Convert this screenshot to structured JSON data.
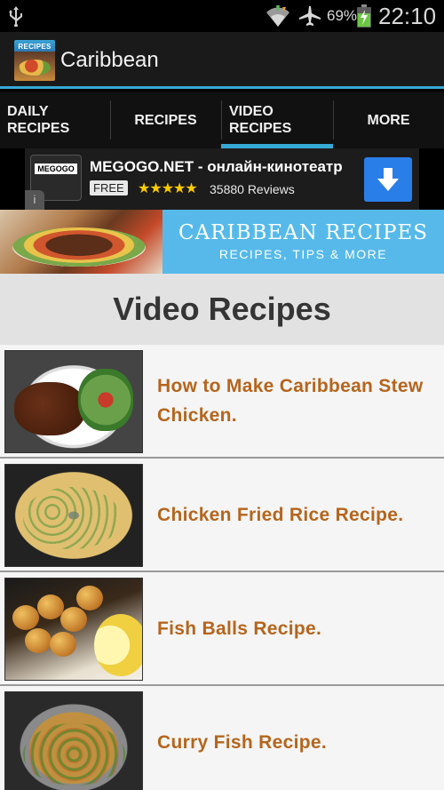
{
  "status_bar": {
    "battery_percent": "69%",
    "time": "22:10",
    "icons": [
      "usb-icon",
      "wifi-icon",
      "airplane-icon",
      "battery-charging-icon"
    ]
  },
  "action_bar": {
    "icon_label": "RECIPES",
    "title": "Caribbean"
  },
  "tabs": [
    {
      "label": "DAILY\nRECIPES",
      "active": false
    },
    {
      "label": "RECIPES",
      "active": false
    },
    {
      "label": "VIDEO\nRECIPES",
      "active": true
    },
    {
      "label": "MORE",
      "active": false
    }
  ],
  "ad": {
    "logo_text": "MEGOGO",
    "title": "MEGOGO.NET - онлайн-кинотеатр",
    "price": "FREE",
    "stars": "★★★★★",
    "rating": 4.5,
    "reviews": "35880 Reviews",
    "info_icon": "info-icon",
    "download_icon": "download-arrow-icon"
  },
  "header_banner": {
    "title": "CARIBBEAN RECIPES",
    "subtitle": "RECIPES, TIPS & MORE"
  },
  "page_heading": "Video Recipes",
  "videos": [
    {
      "title": "How to Make Caribbean Stew Chicken."
    },
    {
      "title": "Chicken Fried Rice Recipe."
    },
    {
      "title": "Fish Balls Recipe."
    },
    {
      "title": "Curry Fish Recipe."
    }
  ],
  "colors": {
    "accent": "#36a9d6",
    "link_text": "#b5651d",
    "banner_blue": "#56b9ea",
    "download_button": "#2a7ee8"
  }
}
